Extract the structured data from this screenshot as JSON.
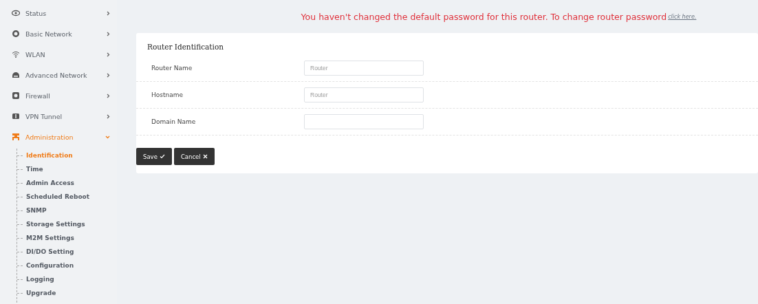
{
  "sidebar": {
    "items": [
      {
        "label": "Status",
        "selected": false,
        "expanded": false
      },
      {
        "label": "Basic Network",
        "selected": false,
        "expanded": false
      },
      {
        "label": "WLAN",
        "selected": false,
        "expanded": false
      },
      {
        "label": "Advanced Network",
        "selected": false,
        "expanded": false
      },
      {
        "label": "Firewall",
        "selected": false,
        "expanded": false
      },
      {
        "label": "VPN Tunnel",
        "selected": false,
        "expanded": false
      },
      {
        "label": "Administration",
        "selected": true,
        "expanded": true,
        "children": [
          {
            "label": "Identification",
            "selected": true
          },
          {
            "label": "Time",
            "selected": false
          },
          {
            "label": "Admin Access",
            "selected": false
          },
          {
            "label": "Scheduled Reboot",
            "selected": false
          },
          {
            "label": "SNMP",
            "selected": false
          },
          {
            "label": "Storage Settings",
            "selected": false
          },
          {
            "label": "M2M Settings",
            "selected": false
          },
          {
            "label": "DI/DO Setting",
            "selected": false
          },
          {
            "label": "Configuration",
            "selected": false
          },
          {
            "label": "Logging",
            "selected": false
          },
          {
            "label": "Upgrade",
            "selected": false
          }
        ]
      }
    ]
  },
  "warning": {
    "text": "You haven't changed the default password for this router. To change router password",
    "link": "click here."
  },
  "card": {
    "title": "Router Identification",
    "fields": [
      {
        "label": "Router Name",
        "placeholder": "Router"
      },
      {
        "label": "Hostname",
        "placeholder": "Router"
      },
      {
        "label": "Domain Name"
      }
    ]
  },
  "buttons": [
    {
      "label": "Save",
      "kind": "save"
    },
    {
      "label": "Cancel",
      "kind": "cancel"
    }
  ]
}
